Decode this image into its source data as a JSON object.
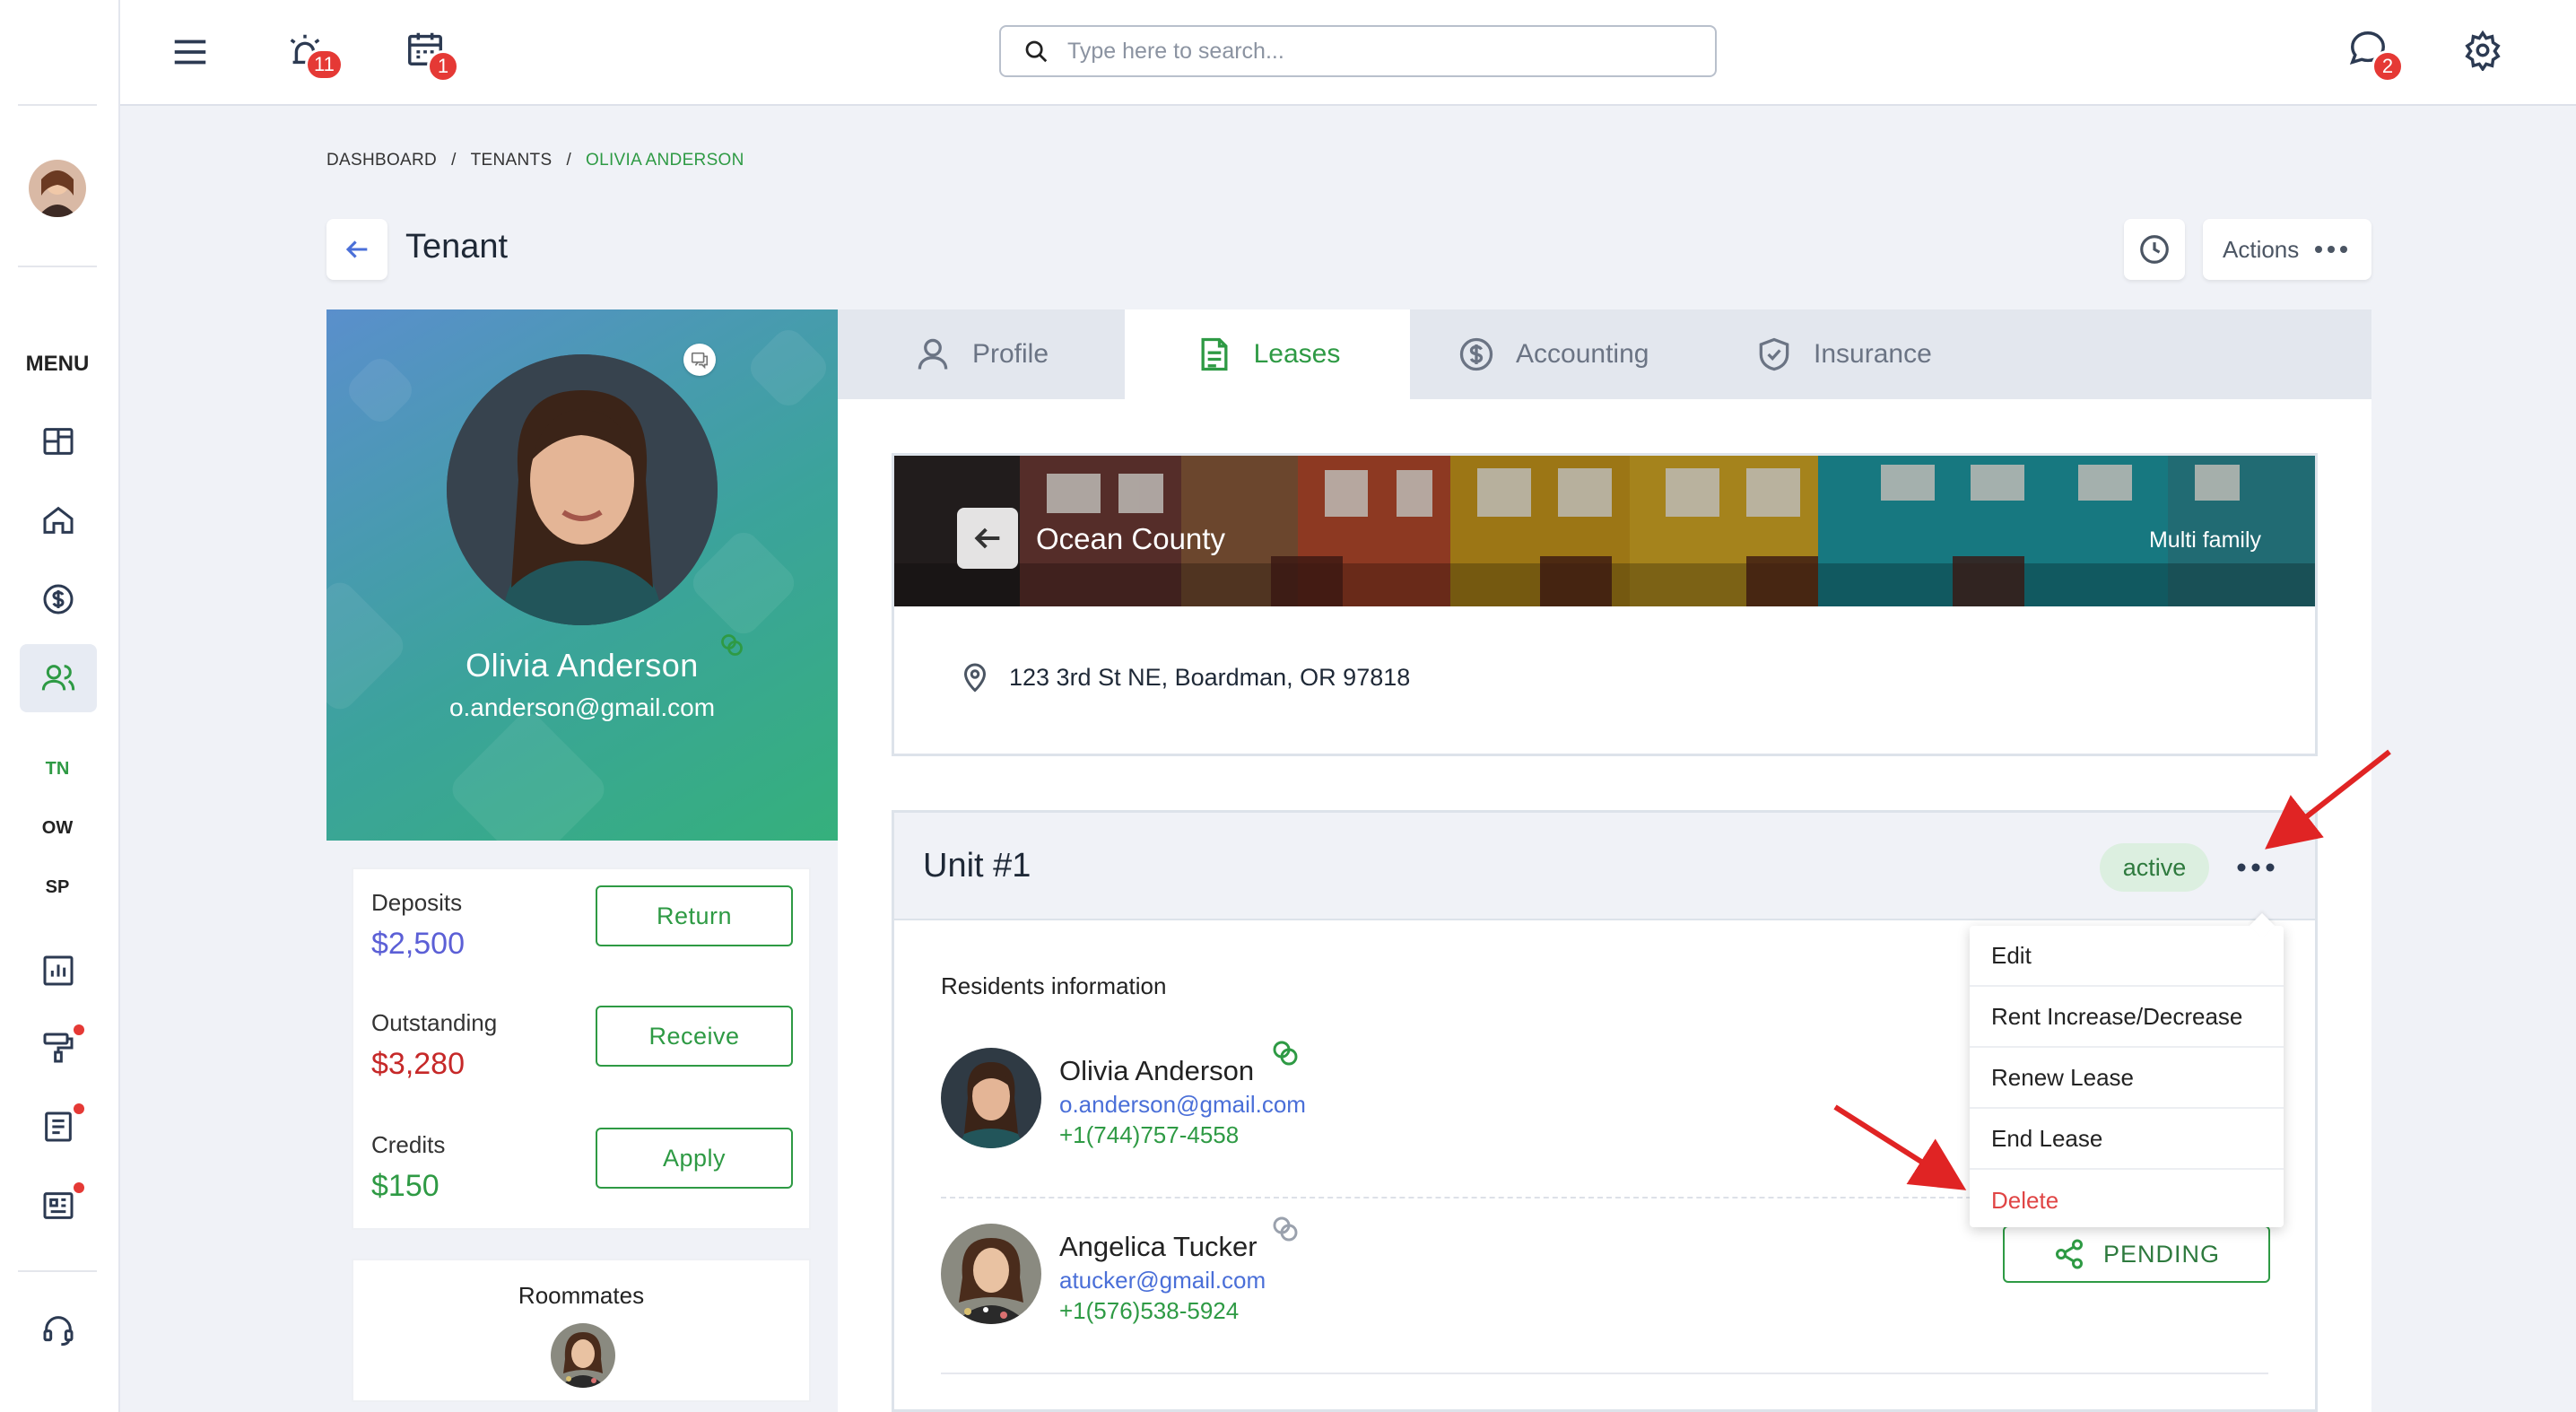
{
  "sidebar": {
    "menu_label": "MENU",
    "shortcuts": [
      "TN",
      "OW",
      "SP"
    ]
  },
  "topbar": {
    "alarm_badge": "11",
    "calendar_badge": "1",
    "chat_badge": "2",
    "search_placeholder": "Type here to search..."
  },
  "breadcrumb": [
    "DASHBOARD",
    "/",
    "TENANTS",
    "/",
    "OLIVIA ANDERSON"
  ],
  "page": {
    "title": "Tenant",
    "actions_label": "Actions"
  },
  "tenant": {
    "name": "Olivia Anderson",
    "email": "o.anderson@gmail.com"
  },
  "finance": {
    "deposits_label": "Deposits",
    "deposits_value": "$2,500",
    "return_label": "Return",
    "outstanding_label": "Outstanding",
    "outstanding_value": "$3,280",
    "receive_label": "Receive",
    "credits_label": "Credits",
    "credits_value": "$150",
    "apply_label": "Apply"
  },
  "roommates_label": "Roommates",
  "tabs": [
    {
      "label": "Profile",
      "icon": "user-icon"
    },
    {
      "label": "Leases",
      "icon": "document-icon"
    },
    {
      "label": "Accounting",
      "icon": "dollar-icon"
    },
    {
      "label": "Insurance",
      "icon": "shield-icon"
    }
  ],
  "property": {
    "name": "Ocean County",
    "type": "Multi family",
    "address": "123 3rd St NE, Boardman, OR 97818"
  },
  "unit": {
    "title": "Unit #1",
    "status": "active",
    "residents_label": "Residents information",
    "residents": [
      {
        "name": "Olivia Anderson",
        "email": "o.anderson@gmail.com",
        "phone": "+1(744)757-4558"
      },
      {
        "name": "Angelica Tucker",
        "email": "atucker@gmail.com",
        "phone": "+1(576)538-5924",
        "status": "PENDING"
      }
    ]
  },
  "menu": [
    "Edit",
    "Rent Increase/Decrease",
    "Renew Lease",
    "End Lease",
    "Delete"
  ],
  "colors": {
    "accent_green": "#2e9a44",
    "danger_red": "#e53935",
    "link_blue": "#4a6fd8",
    "deposit_blue": "#5b5fd6",
    "outstanding_red": "#c62828"
  }
}
